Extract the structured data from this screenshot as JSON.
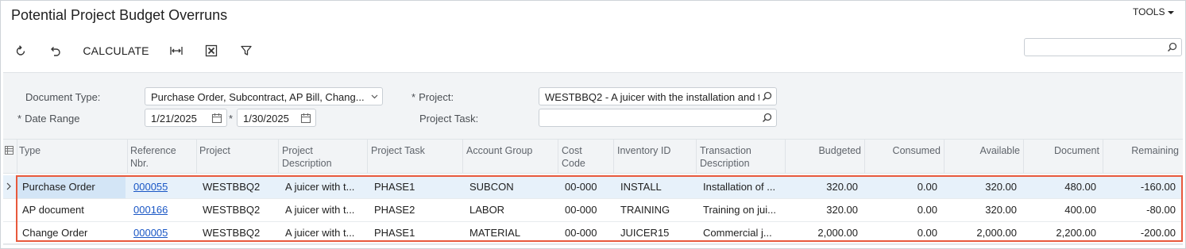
{
  "page": {
    "title": "Potential Project Budget Overruns"
  },
  "header": {
    "tools_label": "TOOLS"
  },
  "toolbar": {
    "calculate_label": "CALCULATE"
  },
  "search": {
    "placeholder": ""
  },
  "filters": {
    "document_type": {
      "label": "Document Type:",
      "value": "Purchase Order, Subcontract, AP Bill, Chang..."
    },
    "date_range": {
      "label": "Date Range",
      "from": "1/21/2025",
      "to": "1/30/2025",
      "separator": "*"
    },
    "project": {
      "label": "Project:",
      "value": "WESTBBQ2 - A juicer with the installation and t"
    },
    "project_task": {
      "label": "Project Task:",
      "value": ""
    },
    "required_marker": "*"
  },
  "grid": {
    "columns": [
      {
        "key": "type",
        "label": "Type"
      },
      {
        "key": "ref",
        "label": "Reference Nbr."
      },
      {
        "key": "project",
        "label": "Project"
      },
      {
        "key": "proj_desc",
        "label": "Project Description"
      },
      {
        "key": "task",
        "label": "Project Task"
      },
      {
        "key": "acct",
        "label": "Account Group"
      },
      {
        "key": "cost",
        "label": "Cost Code"
      },
      {
        "key": "inv",
        "label": "Inventory ID"
      },
      {
        "key": "tran",
        "label": "Transaction Description"
      },
      {
        "key": "budgeted",
        "label": "Budgeted"
      },
      {
        "key": "consumed",
        "label": "Consumed"
      },
      {
        "key": "available",
        "label": "Available"
      },
      {
        "key": "document",
        "label": "Document"
      },
      {
        "key": "remaining",
        "label": "Remaining"
      }
    ],
    "rows": [
      {
        "type": "Purchase Order",
        "ref": "000055",
        "project": "WESTBBQ2",
        "proj_desc": "A juicer with t...",
        "task": "PHASE1",
        "acct": "SUBCON",
        "cost": "00-000",
        "inv": "INSTALL",
        "tran": "Installation of ...",
        "budgeted": "320.00",
        "consumed": "0.00",
        "available": "320.00",
        "document": "480.00",
        "remaining": "-160.00"
      },
      {
        "type": "AP document",
        "ref": "000166",
        "project": "WESTBBQ2",
        "proj_desc": "A juicer with t...",
        "task": "PHASE2",
        "acct": "LABOR",
        "cost": "00-000",
        "inv": "TRAINING",
        "tran": "Training on jui...",
        "budgeted": "320.00",
        "consumed": "0.00",
        "available": "320.00",
        "document": "400.00",
        "remaining": "-80.00"
      },
      {
        "type": "Change Order",
        "ref": "000005",
        "project": "WESTBBQ2",
        "proj_desc": "A juicer with t...",
        "task": "PHASE1",
        "acct": "MATERIAL",
        "cost": "00-000",
        "inv": "JUICER15",
        "tran": "Commercial j...",
        "budgeted": "2,000.00",
        "consumed": "0.00",
        "available": "2,000.00",
        "document": "2,200.00",
        "remaining": "-200.00"
      }
    ]
  },
  "colors": {
    "accent": "#e8593c",
    "link": "#1a57c5",
    "selected_row": "#e7f1fa",
    "panel": "#f2f4f6"
  },
  "icons": [
    "refresh-icon",
    "undo-icon",
    "fit-columns-icon",
    "excel-icon",
    "filter-icon",
    "search-icon",
    "calendar-icon",
    "chevron-down-icon",
    "column-settings-icon",
    "row-pointer-icon"
  ]
}
